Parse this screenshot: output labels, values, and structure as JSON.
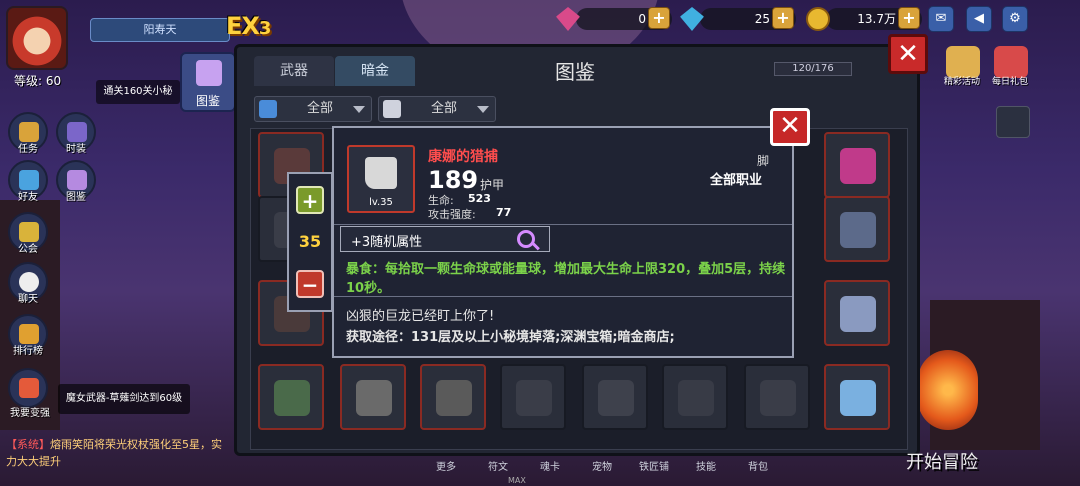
{
  "player": {
    "name": "阳寿天",
    "level_label": "等级: 60"
  },
  "exp_badge": "EX",
  "resources": [
    {
      "icon": "gem-icon",
      "value": "0",
      "color": "#d94a8a"
    },
    {
      "icon": "diamond-icon",
      "value": "25",
      "color": "#40b0e0"
    },
    {
      "icon": "gold-coin-icon",
      "value": "13.7万",
      "color": "#e8b830"
    }
  ],
  "left_menu": {
    "clear_text": "通关160关小秘",
    "codex_label": "图鉴",
    "items": [
      {
        "label": "任务",
        "icon": "task-icon",
        "color": "#d9a33a"
      },
      {
        "label": "时装",
        "icon": "costume-icon",
        "color": "#7b66c9"
      },
      {
        "label": "好友",
        "icon": "friends-icon",
        "color": "#4aa3df"
      },
      {
        "label": "图鉴",
        "icon": "codex-icon",
        "color": "#b58ae0"
      },
      {
        "label": "公会",
        "icon": "guild-icon",
        "color": "#d9b33a"
      },
      {
        "label": "聊天",
        "icon": "chat-icon",
        "color": "#eeeeee"
      },
      {
        "label": "排行榜",
        "icon": "ranking-icon",
        "color": "#e0a030"
      },
      {
        "label": "我要变强",
        "icon": "power-up-icon",
        "color": "#e45a3a"
      }
    ]
  },
  "quest_text": "魔女武器-草薙剑达到60级",
  "system_message": {
    "tag": "【系统】",
    "text": "熔雨笑陌将荣光权杖强化至5星，实力大大提升"
  },
  "codex": {
    "title": "图鉴",
    "tabs": [
      "武器",
      "暗金"
    ],
    "active_tab": "暗金",
    "progress_label": "120/176",
    "progress": 0.68,
    "filters": [
      {
        "label": "全部",
        "icon": "grid-filter-icon"
      },
      {
        "label": "全部",
        "icon": "demon-filter-icon"
      }
    ]
  },
  "right_menu": [
    {
      "label": "精彩活动",
      "icon": "event-icon",
      "color": "#e0b050"
    },
    {
      "label": "每日礼包",
      "icon": "gift-icon",
      "color": "#d84a4a"
    }
  ],
  "item": {
    "name": "康娜的猎捕",
    "level": "lv.35",
    "value": "189",
    "value_type": "护甲",
    "stats": [
      {
        "label": "生命:",
        "value": "523"
      },
      {
        "label": "攻击强度:",
        "value": "77"
      }
    ],
    "slot": "脚",
    "class": "全部职业",
    "random_attr": "+3随机属性",
    "effect": "暴食：每拾取一颗生命球或能量球，增加最大生命上限320，叠加5层，持续10秒。",
    "lore": "凶狠的巨龙已经盯上你了!",
    "source": "获取途径：131层及以上小秘境掉落;深渊宝箱;暗金商店;"
  },
  "quantity": {
    "value": "35"
  },
  "bottom_tabs": [
    "更多",
    "符文",
    "魂卡",
    "宠物",
    "铁匠铺",
    "技能",
    "背包"
  ],
  "start_button": "开始冒险",
  "max_label": "MAX"
}
